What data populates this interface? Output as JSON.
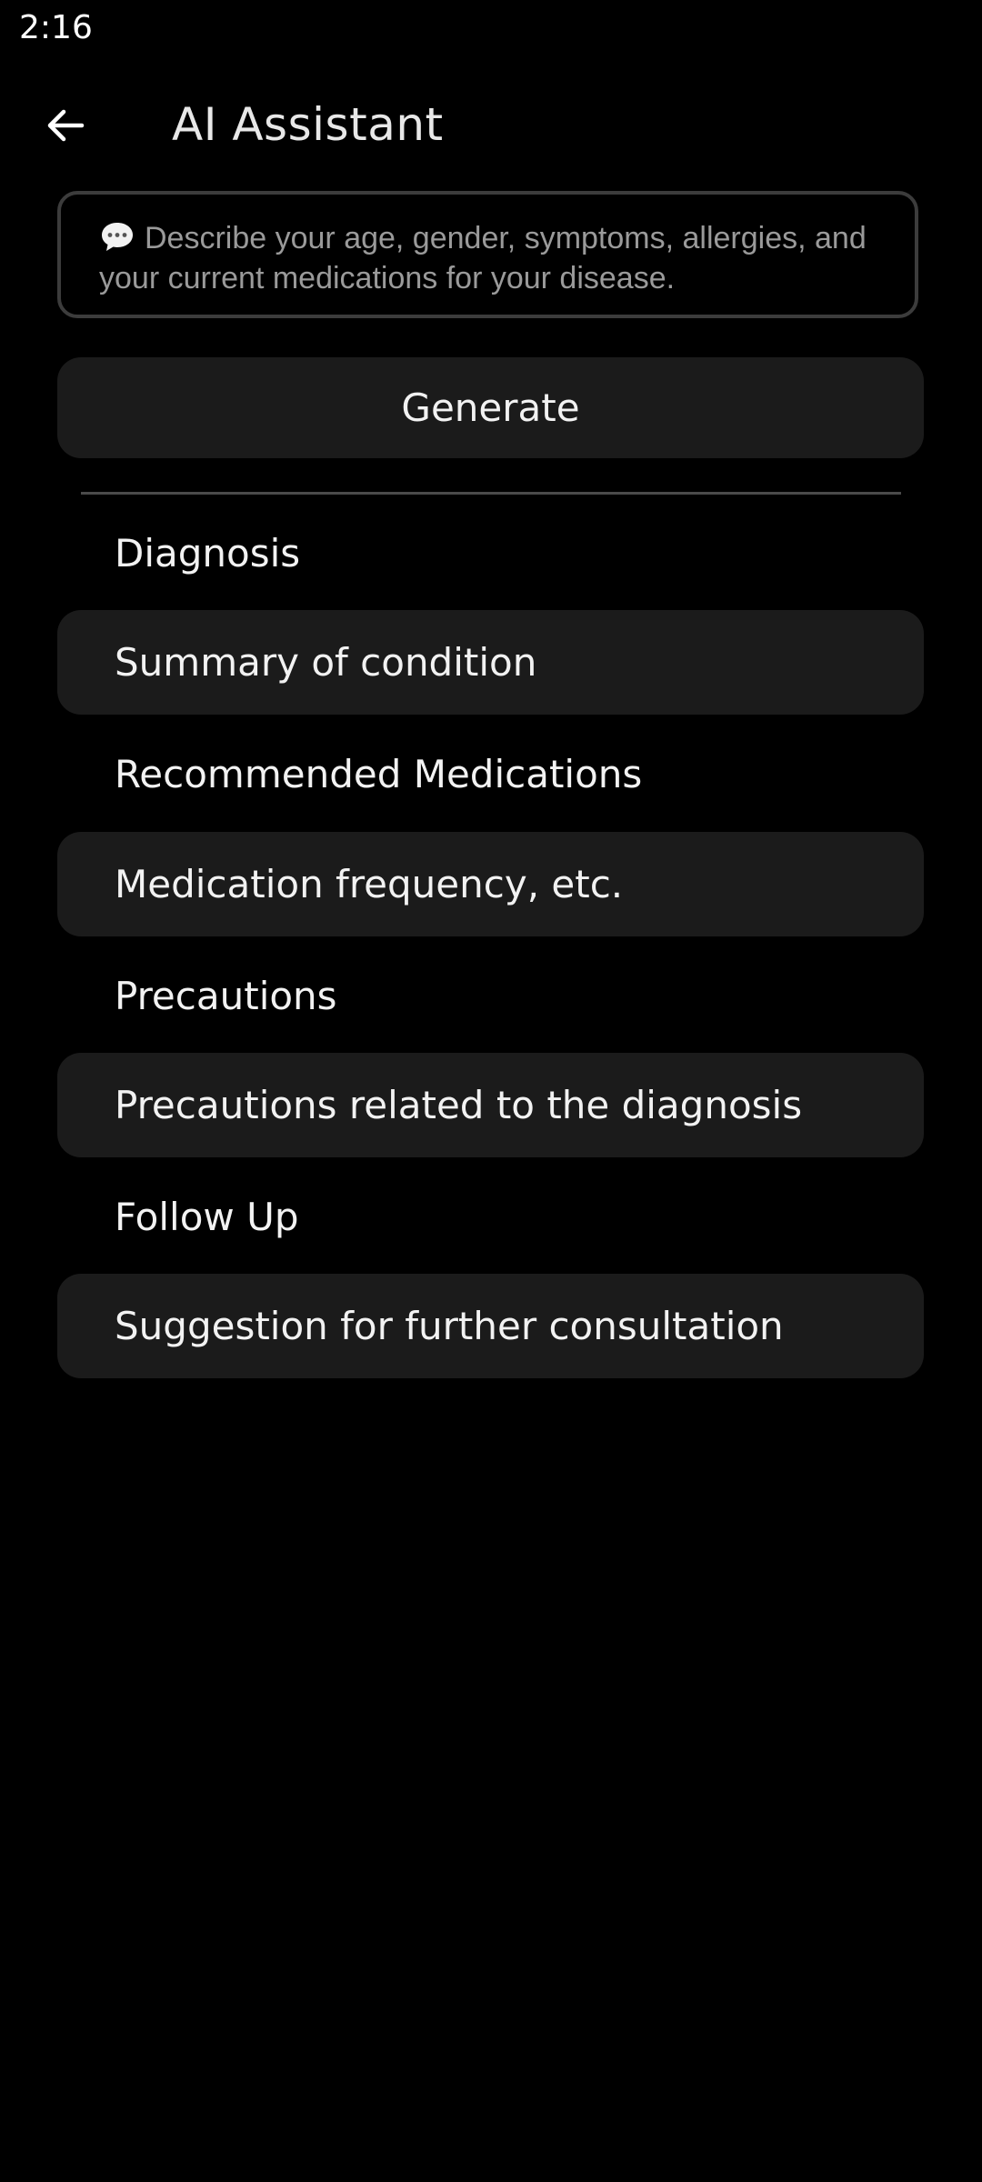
{
  "status_bar": {
    "time": "2:16"
  },
  "app_bar": {
    "back_icon": "arrow-left-icon",
    "title": "AI Assistant"
  },
  "prompt": {
    "icon": "speech-bubble-icon",
    "placeholder": "Describe your age, gender, symptoms, allergies, and your current medications for your disease.",
    "value": ""
  },
  "generate_button": {
    "label": "Generate"
  },
  "sections": [
    {
      "label": "Diagnosis",
      "content": "Summary of condition"
    },
    {
      "label": "Recommended Medications",
      "content": "Medication frequency, etc."
    },
    {
      "label": "Precautions",
      "content": "Precautions related to the diagnosis"
    },
    {
      "label": "Follow Up",
      "content": "Suggestion for further consultation"
    }
  ],
  "colors": {
    "background": "#000000",
    "card": "#1b1b1b",
    "border": "#3c3c3c",
    "text": "#f2f2f2",
    "placeholder": "#9a9a9a"
  }
}
